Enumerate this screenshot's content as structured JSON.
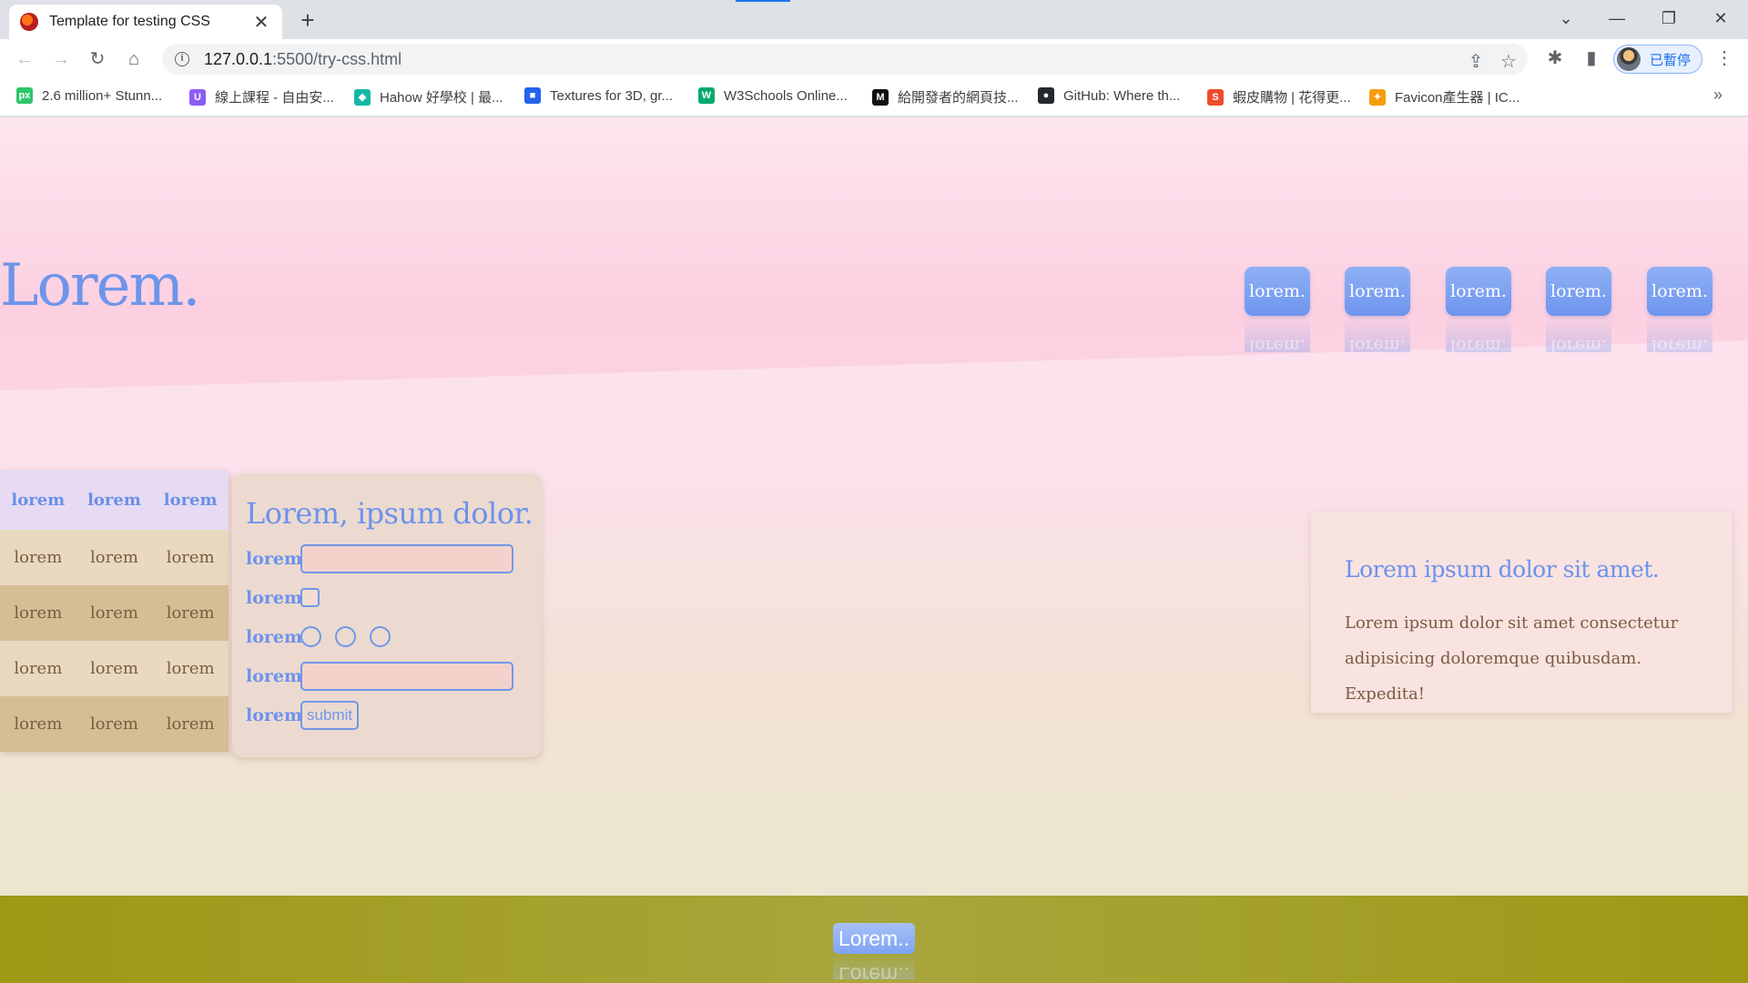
{
  "browser": {
    "tab_title": "Template for testing CSS",
    "url_host": "127.0.0.1",
    "url_rest": ":5500/try-css.html",
    "profile_label": "已暫停",
    "bookmarks": [
      {
        "label": "2.6 million+ Stunn...",
        "icon": "pixabay-icon",
        "color": "#2ec66b"
      },
      {
        "label": "線上課程 - 自由安...",
        "icon": "hahow-u-icon",
        "color": "#8b5cf6"
      },
      {
        "label": "Hahow 好學校 | 最...",
        "icon": "hahow-icon",
        "color": "#14b8a6"
      },
      {
        "label": "Textures for 3D, gr...",
        "icon": "textures-icon",
        "color": "#2563eb"
      },
      {
        "label": "W3Schools Online...",
        "icon": "w3schools-icon",
        "color": "#04aa6d"
      },
      {
        "label": "給開發者的網頁技...",
        "icon": "mdn-icon",
        "color": "#111111"
      },
      {
        "label": "GitHub: Where th...",
        "icon": "github-icon",
        "color": "#24292f"
      },
      {
        "label": "蝦皮購物 | 花得更...",
        "icon": "shopee-icon",
        "color": "#ee4d2d"
      },
      {
        "label": "Favicon產生器 | IC...",
        "icon": "favicon-icon",
        "color": "#f59e0b"
      }
    ]
  },
  "page": {
    "hero_title": "Lorem.",
    "nav_items": [
      "lorem.",
      "lorem.",
      "lorem.",
      "lorem.",
      "lorem."
    ],
    "table": {
      "header": [
        "lorem",
        "lorem",
        "lorem"
      ],
      "rows": [
        [
          "lorem",
          "lorem",
          "lorem"
        ],
        [
          "lorem",
          "lorem",
          "lorem"
        ],
        [
          "lorem",
          "lorem",
          "lorem"
        ],
        [
          "lorem",
          "lorem",
          "lorem"
        ]
      ]
    },
    "form": {
      "title": "Lorem, ipsum dolor.",
      "labels": [
        "lorem",
        "lorem",
        "lorem",
        "lorem",
        "lorem"
      ],
      "submit_label": "submit"
    },
    "info_card": {
      "title": "Lorem ipsum dolor sit amet.",
      "body": "Lorem ipsum dolor sit amet consectetur adipisicing doloremque quibusdam. Expedita!"
    },
    "footer_button": "Lorem.."
  },
  "colors": {
    "accent_blue": "#6d92ec",
    "text_brown": "#7a5c40",
    "footer_olive": "#9e9915"
  }
}
